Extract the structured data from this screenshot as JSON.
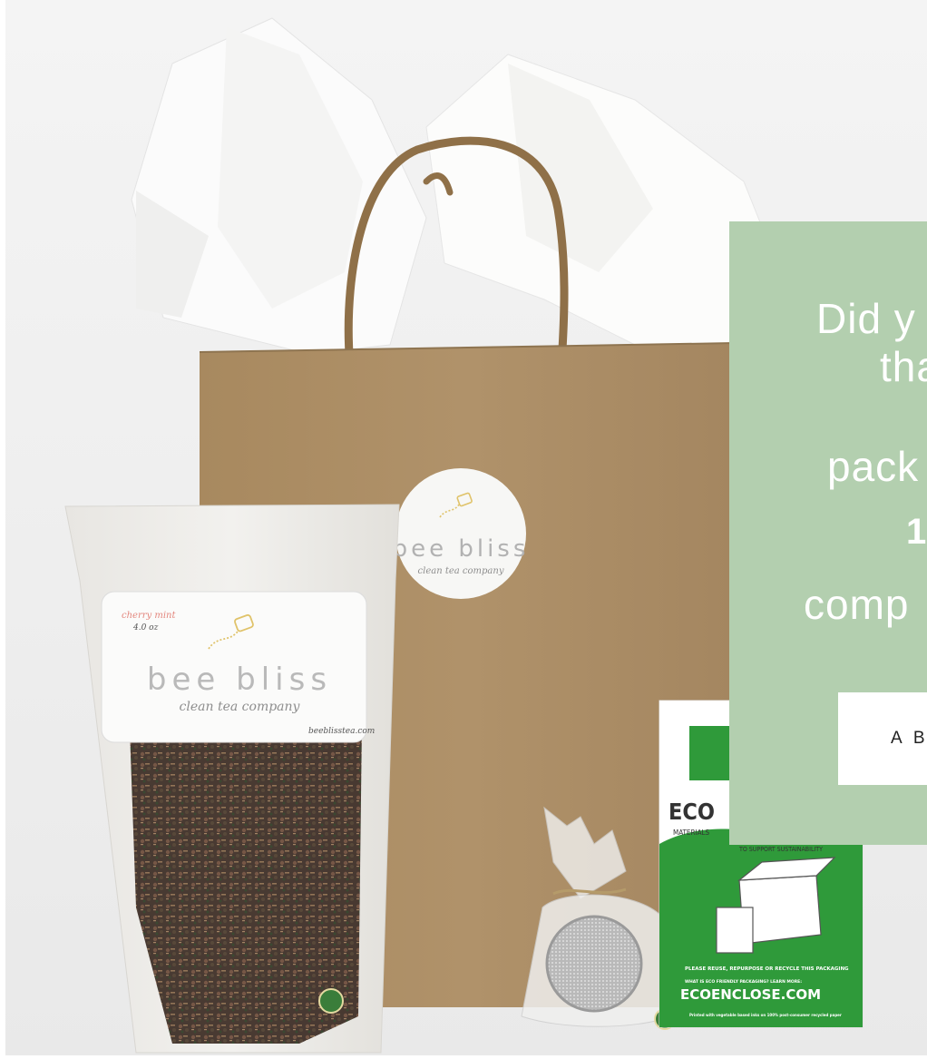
{
  "hero": {
    "bag_sticker": {
      "brand": "bee bliss",
      "tagline": "clean tea company"
    },
    "pouch_label": {
      "flavor": "cherry mint",
      "weight": "4.0 oz",
      "brand": "bee bliss",
      "tagline": "clean tea company",
      "url": "beeblisstea.com"
    },
    "insert_card": {
      "line1": "ECO",
      "line2": "MATERIALS",
      "line3": "TO SUPPORT SUSTAINABILITY",
      "reuse": "PLEASE REUSE, REPURPOSE OR RECYCLE THIS PACKAGING",
      "learn": "WHAT IS ECO FRIENDLY PACKAGING? LEARN MORE:",
      "site": "ECOENCLOSE.COM",
      "fine_print": "Printed with vegetable based inks on 100% post-consumer recycled paper"
    }
  },
  "info_panel": {
    "lines": [
      "Did y",
      "tha",
      "pack",
      "1",
      "comp"
    ],
    "button_label": "A B"
  },
  "colors": {
    "panel": "#b3cfaf",
    "kraft": "#a88b63",
    "card_green": "#2f9a3a"
  }
}
